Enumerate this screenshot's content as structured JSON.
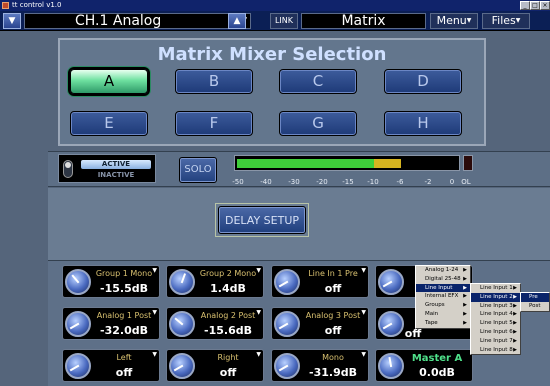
{
  "window": {
    "title": "tt control  v1.0"
  },
  "toolbar": {
    "channel_name": "CH.1 Analog",
    "link_label": "LINK",
    "view_name": "Matrix",
    "menu_label": "Menu",
    "files_label": "Files"
  },
  "matrix_selection": {
    "title": "Matrix Mixer Selection",
    "buttons": [
      {
        "label": "A",
        "active": true
      },
      {
        "label": "B",
        "active": false
      },
      {
        "label": "C",
        "active": false
      },
      {
        "label": "D",
        "active": false
      },
      {
        "label": "E",
        "active": false
      },
      {
        "label": "F",
        "active": false
      },
      {
        "label": "G",
        "active": false
      },
      {
        "label": "H",
        "active": false
      }
    ]
  },
  "status": {
    "active_label": "ACTIVE",
    "inactive_label": "INACTIVE",
    "solo_label": "SOLO",
    "meter_ticks": [
      "-50",
      "-40",
      "-30",
      "-20",
      "-15",
      "-10",
      "-6",
      "-2",
      "0",
      "OL"
    ],
    "meter_green_level_db": -10,
    "meter_yellow_level_db": -6
  },
  "delay": {
    "button_label": "DELAY SETUP"
  },
  "channels": [
    {
      "label": "Group 1 Mono",
      "value": "-15.5dB"
    },
    {
      "label": "Group 2 Mono",
      "value": "1.4dB"
    },
    {
      "label": "Line In 1 Pre",
      "value": "off"
    },
    {
      "label": "Analog 1 Post",
      "value": "-32.0dB"
    },
    {
      "label": "Analog 2 Post",
      "value": "-15.6dB"
    },
    {
      "label": "Analog 3 Post",
      "value": "off"
    },
    {
      "label": "Left",
      "value": "off"
    },
    {
      "label": "Right",
      "value": "off"
    },
    {
      "label": "Mono",
      "value": "-31.9dB"
    }
  ],
  "master": {
    "label": "Master A",
    "value": "0.0dB"
  },
  "partial_cells": [
    {
      "value": "off"
    }
  ],
  "context_menu": {
    "level1": [
      "Analog 1-24",
      "Digital 25-48",
      "Line Input",
      "Internal EFX",
      "Groups",
      "Main",
      "Tape"
    ],
    "level1_highlight": "Line Input",
    "level2": [
      "Line Input 1",
      "Line Input 2",
      "Line Input 3",
      "Line Input 4",
      "Line Input 5",
      "Line Input 6",
      "Line Input 7",
      "Line Input 8"
    ],
    "level2_highlight": "Line Input 2",
    "level3": [
      "Pre",
      "Post"
    ],
    "level3_highlight": "Pre"
  },
  "colors": {
    "accent_green": "#4fe08a",
    "panel_blue": "#1e3a78",
    "label_gold": "#d8c070"
  }
}
